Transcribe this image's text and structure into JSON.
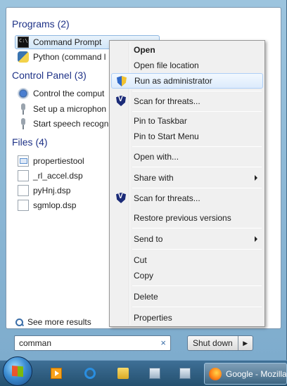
{
  "start_menu": {
    "groups": {
      "programs": {
        "header": "Programs (2)"
      },
      "control_panel": {
        "header": "Control Panel (3)"
      },
      "files": {
        "header": "Files (4)"
      }
    },
    "programs": [
      {
        "label": "Command Prompt",
        "icon": "command-prompt-icon"
      },
      {
        "label": "Python (command l",
        "icon": "python-icon"
      }
    ],
    "control_panel": [
      {
        "label": "Control the comput",
        "icon": "control-panel-icon"
      },
      {
        "label": "Set up a microphon",
        "icon": "microphone-icon"
      },
      {
        "label": "Start speech recogn",
        "icon": "microphone-icon"
      }
    ],
    "files": [
      {
        "label": "propertiestool",
        "icon": "file-icon"
      },
      {
        "label": "_rl_accel.dsp",
        "icon": "file-icon"
      },
      {
        "label": "pyHnj.dsp",
        "icon": "file-icon"
      },
      {
        "label": "sgmlop.dsp",
        "icon": "file-icon"
      }
    ],
    "see_more": "See more results",
    "search_value": "comman",
    "search_clear": "×",
    "shutdown_label": "Shut down",
    "shutdown_arrow": "▶"
  },
  "context_menu": {
    "items": [
      {
        "label": "Open"
      },
      {
        "label": "Open file location"
      },
      {
        "label": "Run as administrator"
      },
      {
        "label": "Scan for threats..."
      },
      {
        "label": "Pin to Taskbar"
      },
      {
        "label": "Pin to Start Menu"
      },
      {
        "label": "Open with..."
      },
      {
        "label": "Share with"
      },
      {
        "label": "Scan for threats..."
      },
      {
        "label": "Restore previous versions"
      },
      {
        "label": "Send to"
      },
      {
        "label": "Cut"
      },
      {
        "label": "Copy"
      },
      {
        "label": "Delete"
      },
      {
        "label": "Properties"
      }
    ]
  },
  "taskbar": {
    "firefox_label": "Google - Mozilla"
  }
}
